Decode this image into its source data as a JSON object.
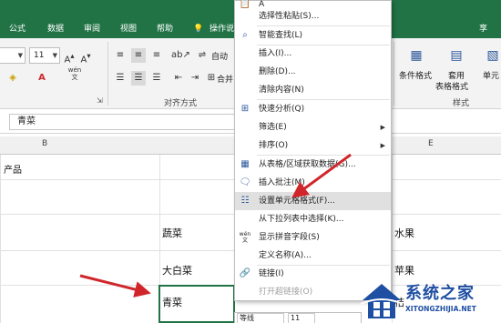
{
  "ribbon_tabs": [
    "公式",
    "数据",
    "审阅",
    "视图",
    "帮助",
    "操作说",
    "享"
  ],
  "ribbon": {
    "font_size": "11",
    "autowrap_label": "自动",
    "merge_label": "合并",
    "align_group_label": "对齐方式",
    "cond_format_label": "条件格式",
    "table_format_label1": "套用",
    "table_format_label2": "表格格式",
    "cell_style_label": "单元",
    "styles_group_label": "样式",
    "wen_icon": "wén"
  },
  "formula_bar": {
    "value": "青菜"
  },
  "sheet": {
    "col_headers": [
      "B",
      "E"
    ],
    "row1_label": "产品",
    "cells": {
      "d_veg1": "蔬菜",
      "d_veg2": "大白菜",
      "d_veg3": "青菜",
      "f_fruit1": "水果",
      "f_fruit2": "苹果",
      "f_fruit3": "桔"
    }
  },
  "context_menu": {
    "items": [
      {
        "label": "A",
        "icon": "paste-icon"
      },
      {
        "label": "选择性粘贴(S)...",
        "icon": ""
      },
      {
        "label": "智能查找(L)",
        "icon": "search-icon"
      },
      {
        "label": "插入(I)...",
        "icon": ""
      },
      {
        "label": "删除(D)...",
        "icon": ""
      },
      {
        "label": "清除内容(N)",
        "icon": ""
      },
      {
        "label": "快速分析(Q)",
        "icon": "quick-analysis-icon"
      },
      {
        "label": "筛选(E)",
        "icon": "",
        "submenu": true
      },
      {
        "label": "排序(O)",
        "icon": "",
        "submenu": true
      },
      {
        "label": "从表格/区域获取数据(G)...",
        "icon": "table-icon"
      },
      {
        "label": "插入批注(M)",
        "icon": "comment-icon"
      },
      {
        "label": "设置单元格格式(F)...",
        "icon": "format-cells-icon",
        "highlighted": true
      },
      {
        "label": "从下拉列表中选择(K)...",
        "icon": ""
      },
      {
        "label": "显示拼音字段(S)",
        "icon": "phonetic-icon"
      },
      {
        "label": "定义名称(A)...",
        "icon": ""
      },
      {
        "label": "链接(I)",
        "icon": "link-icon"
      },
      {
        "label": "打开超链接(O)",
        "icon": "",
        "disabled": true
      }
    ]
  },
  "mini_toolbar": {
    "font": "等线",
    "size": "11"
  },
  "watermark": {
    "title": "系统之家",
    "url": "XITONGZHIJIA.NET"
  },
  "colors": {
    "ribbon_green": "#217346",
    "arrow_red": "#d0262b",
    "highlight": "#e0e0e0"
  }
}
